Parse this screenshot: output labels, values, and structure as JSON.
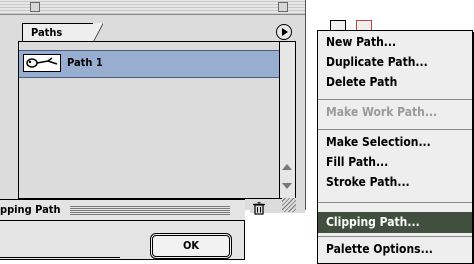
{
  "palette": {
    "tab_label": "Paths",
    "path_items": [
      {
        "name": "Path 1"
      }
    ]
  },
  "dialog": {
    "title": "pping Path",
    "ok_label": "OK"
  },
  "menu": {
    "items": [
      {
        "label": "New Path...",
        "enabled": true
      },
      {
        "label": "Duplicate Path...",
        "enabled": true
      },
      {
        "label": "Delete Path",
        "enabled": true
      },
      {
        "label": "Make Work Path...",
        "enabled": false
      },
      {
        "label": "Make Selection...",
        "enabled": true
      },
      {
        "label": "Fill Path...",
        "enabled": true
      },
      {
        "label": "Stroke Path...",
        "enabled": true
      },
      {
        "label": "Clipping Path...",
        "enabled": true,
        "highlighted": true
      },
      {
        "label": "Palette Options...",
        "enabled": true
      }
    ]
  },
  "colors": {
    "selection": "#97aed0",
    "menu_highlight": "#414f3f",
    "disabled_text": "#9a9a9a"
  },
  "icons": [
    "palette-menu-arrow-icon",
    "path-thumbnail-icon",
    "trash-icon",
    "scroll-up-icon",
    "scroll-down-icon",
    "resize-grip-icon"
  ]
}
